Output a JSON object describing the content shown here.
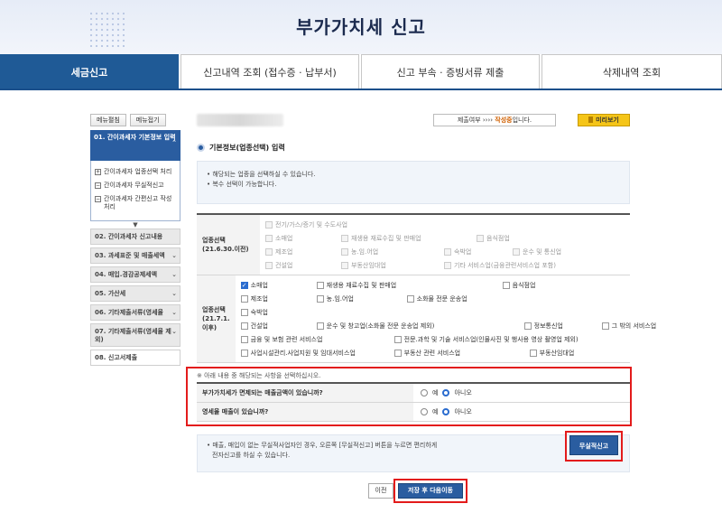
{
  "page_title": "부가가치세 신고",
  "tabs": [
    {
      "label": "세금신고",
      "active": true
    },
    {
      "label": "신고내역 조회 (접수증 · 납부서)",
      "active": false
    },
    {
      "label": "신고 부속 · 증빙서류 제출",
      "active": false
    },
    {
      "label": "삭제내역 조회",
      "active": false
    }
  ],
  "sidebar": {
    "expand_all": "메뉴펼침",
    "collapse_all": "메뉴접기",
    "active_step": "01. 간이과세자 기본정보 입력",
    "sub_items": [
      {
        "mark": "+",
        "label": "간이과세자 업종선택 처리"
      },
      {
        "mark": "−",
        "label": "간이과세자 무실적신고"
      },
      {
        "mark": "−",
        "label": "간이과세자 간편신고 작성 처리"
      }
    ],
    "steps": [
      {
        "label": "02. 간이과세자 신고내용",
        "chevron": false,
        "tall": false
      },
      {
        "label": "03. 과세표준 및 매출세액",
        "chevron": true,
        "tall": false
      },
      {
        "label": "04. 매입.경감공제세액",
        "chevron": true,
        "tall": false
      },
      {
        "label": "05. 가산세",
        "chevron": true,
        "tall": false
      },
      {
        "label": "06. 기타제출서류(영세율",
        "chevron": true,
        "tall": false
      },
      {
        "label": "07. 기타제출서류(영세율 제외)",
        "chevron": true,
        "tall": true
      }
    ],
    "current_step": "08. 신고서제출"
  },
  "status": {
    "prefix": "제출여부",
    "arrows": "››››",
    "state": "작성중",
    "suffix": "입니다.",
    "preview_label": "미리보기"
  },
  "section_title": "기본정보(업종선택) 입력",
  "notes": [
    "• 해당되는 업종을 선택하실 수 있습니다.",
    "• 복수 선택이 가능합니다."
  ],
  "old_business": {
    "head": "업종선택",
    "head_sub": "(21.6.30.이전)",
    "rows": [
      [
        {
          "label": "전기/가스/증기 및 수도사업",
          "checked": false
        }
      ],
      [
        {
          "label": "소매업",
          "checked": false
        },
        {
          "label": "재생용 재료수집 및 판매업",
          "checked": false
        },
        {
          "label": "음식점업",
          "checked": false
        }
      ],
      [
        {
          "label": "제조업",
          "checked": false
        },
        {
          "label": "농.임.어업",
          "checked": false
        },
        {
          "label": "숙박업",
          "checked": false
        },
        {
          "label": "운수 및 통신업",
          "checked": false
        }
      ],
      [
        {
          "label": "건설업",
          "checked": false
        },
        {
          "label": "부동산임대업",
          "checked": false
        },
        {
          "label": "기타 서비스업(금융관련서비스업 포함)",
          "checked": false
        }
      ]
    ]
  },
  "new_business": {
    "head": "업종선택",
    "head_sub": "(21.7.1.이후)",
    "rows": [
      [
        {
          "label": "소매업",
          "checked": true
        },
        {
          "label": "재생용 재료수집 및 판매업",
          "checked": false
        },
        {
          "label": "음식점업",
          "checked": false
        }
      ],
      [
        {
          "label": "제조업",
          "checked": false
        },
        {
          "label": "농.임.어업",
          "checked": false
        },
        {
          "label": "소화물 전문 운송업",
          "checked": false
        }
      ],
      [
        {
          "label": "숙박업",
          "checked": false
        }
      ],
      [
        {
          "label": "건설업",
          "checked": false
        },
        {
          "label": "운수 및 창고업(소화물 전문 운송업 제외)",
          "checked": false
        },
        {
          "label": "정보통신업",
          "checked": false
        },
        {
          "label": "그 밖의 서비스업",
          "checked": false
        }
      ],
      [
        {
          "label": "금융 및 보험 관련 서비스업",
          "checked": false
        },
        {
          "label": "전문.과학 및 기술 서비스업(인물사진 및 행사용 영상 촬영업 제외)",
          "checked": false
        }
      ],
      [
        {
          "label": "사업시설관리.사업지원 및 임대서비스업",
          "checked": false
        },
        {
          "label": "부동산 관련 서비스업",
          "checked": false
        },
        {
          "label": "부동산임대업",
          "checked": false
        }
      ]
    ]
  },
  "questions": {
    "note": "※ 아래 내용 중 해당되는 사항을 선택하십시오.",
    "items": [
      {
        "label": "부가가치세가 면제되는 매출금액이 있습니까?",
        "yes": "예",
        "no": "아니오",
        "selected": "no"
      },
      {
        "label": "영세율 매출이 있습니까?",
        "yes": "예",
        "no": "아니오",
        "selected": "no"
      }
    ]
  },
  "footer_note": [
    "• 매출, 매입이 없는 무실적사업자인 경우, 오른쪽 [무실적신고] 버튼을 누르면 편리하게",
    "전자신고를 하실 수 있습니다."
  ],
  "nil_report_label": "무실적신고",
  "prev_label": "이전",
  "next_label": "저장 후 다음이동"
}
